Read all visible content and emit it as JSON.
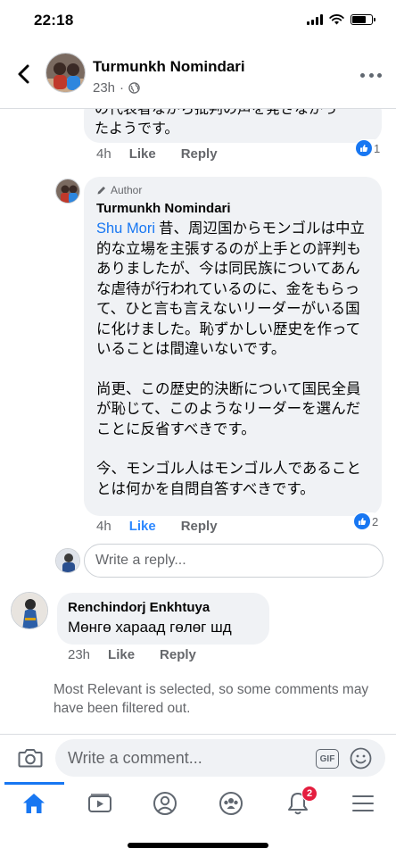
{
  "status_bar": {
    "time": "22:18"
  },
  "header": {
    "name": "Turmunkh Nomindari",
    "time": "23h"
  },
  "comments": {
    "prev_reply": {
      "text_line1": "の代表者ながら批判の声を発さなかっ",
      "text_line2": "たようです。",
      "time": "4h",
      "like": "Like",
      "reply": "Reply",
      "reactions": "1"
    },
    "author_reply": {
      "badge": "Author",
      "name": "Turmunkh Nomindari",
      "mention": "Shu Mori",
      "paragraphs": [
        "昔、周辺国からモンゴルは中立的な立場を主張するのが上手との評判もありましたが、今は同民族についてあんな虐待が行われているのに、金をもらって、ひと言も言えないリーダーがいる国に化けました。恥ずかしい歴史を作っていることは間違いないです。",
        "尚更、この歴史的決断について国民全員が恥じて、このようなリーダーを選んだことに反省すべきです。",
        "今、モンゴル人はモンゴル人であることとは何かを自問自答すべきです。"
      ],
      "time": "4h",
      "like": "Like",
      "reply": "Reply",
      "reactions": "2"
    },
    "write_reply_placeholder": "Write a reply...",
    "comment2": {
      "name": "Renchindorj Enkhtuya",
      "text": "Мөнгө хараад гөлөг шд",
      "time": "23h",
      "like": "Like",
      "reply": "Reply"
    },
    "filter_note": "Most Relevant is selected, so some comments may have been filtered out."
  },
  "composer": {
    "placeholder": "Write a comment...",
    "gif_label": "GIF"
  },
  "nav": {
    "notifications_count": "2"
  },
  "colors": {
    "accent": "#1877f2",
    "bubble": "#f0f2f5",
    "meta": "#65676b",
    "badge": "#e41e3f"
  }
}
